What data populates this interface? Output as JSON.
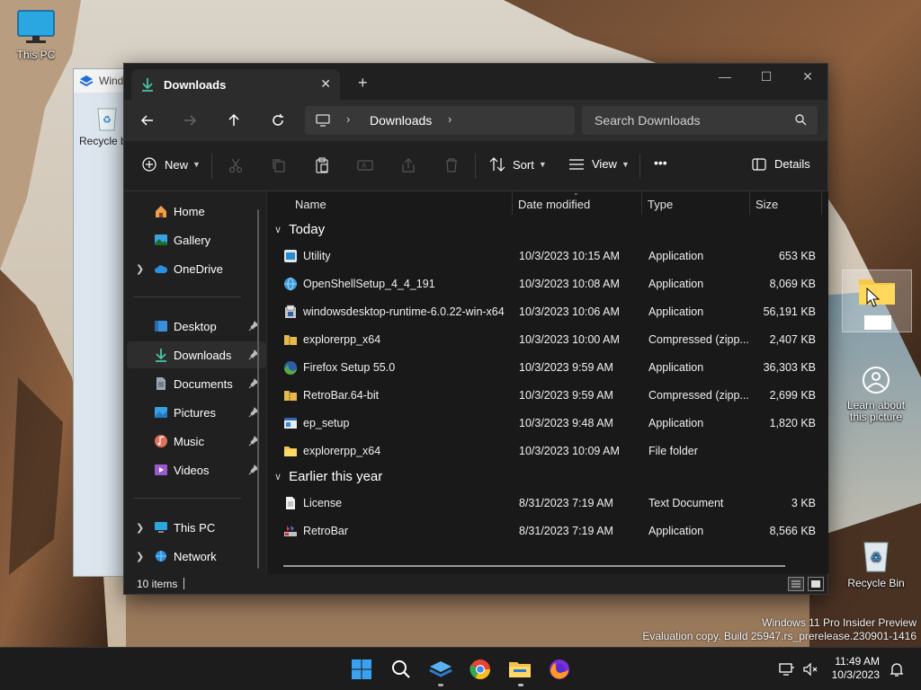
{
  "desktop": {
    "this_pc_label": "This PC",
    "learn_label_1": "Learn about",
    "learn_label_2": "this picture",
    "recycle_bin_label": "Recycle Bin",
    "watermark_line1": "Windows 11 Pro Insider Preview",
    "watermark_line2": "Evaluation copy. Build 25947.rs_prerelease.230901-1416"
  },
  "background_window": {
    "title": "Wind",
    "recycle_label": "Recycle b"
  },
  "explorer": {
    "tab_title": "Downloads",
    "new_tab": "+",
    "address_crumb": "Downloads",
    "search_placeholder": "Search Downloads",
    "toolbar": {
      "new_label": "New",
      "sort_label": "Sort",
      "view_label": "View",
      "more_label": "•••",
      "details_label": "Details"
    },
    "nav": [
      {
        "label": "Home"
      },
      {
        "label": "Gallery"
      },
      {
        "label": "OneDrive"
      },
      {
        "label": "Desktop"
      },
      {
        "label": "Downloads"
      },
      {
        "label": "Documents"
      },
      {
        "label": "Pictures"
      },
      {
        "label": "Music"
      },
      {
        "label": "Videos"
      },
      {
        "label": "This PC"
      },
      {
        "label": "Network"
      }
    ],
    "columns": {
      "name": "Name",
      "date": "Date modified",
      "type": "Type",
      "size": "Size"
    },
    "groups": [
      {
        "label": "Today",
        "files": [
          {
            "name": "Utility",
            "date": "10/3/2023 10:15 AM",
            "type": "Application",
            "size": "653 KB",
            "icon": "app-icon"
          },
          {
            "name": "OpenShellSetup_4_4_191",
            "date": "10/3/2023 10:08 AM",
            "type": "Application",
            "size": "8,069 KB",
            "icon": "globe-installer-icon"
          },
          {
            "name": "windowsdesktop-runtime-6.0.22-win-x64",
            "date": "10/3/2023 10:06 AM",
            "type": "Application",
            "size": "56,191 KB",
            "icon": "installer-icon"
          },
          {
            "name": "explorerpp_x64",
            "date": "10/3/2023 10:00 AM",
            "type": "Compressed (zipp...",
            "size": "2,407 KB",
            "icon": "zip-icon"
          },
          {
            "name": "Firefox Setup 55.0",
            "date": "10/3/2023 9:59 AM",
            "type": "Application",
            "size": "36,303 KB",
            "icon": "firefox-setup-icon"
          },
          {
            "name": "RetroBar.64-bit",
            "date": "10/3/2023 9:59 AM",
            "type": "Compressed (zipp...",
            "size": "2,699 KB",
            "icon": "zip-icon"
          },
          {
            "name": "ep_setup",
            "date": "10/3/2023 9:48 AM",
            "type": "Application",
            "size": "1,820 KB",
            "icon": "app-window-icon"
          },
          {
            "name": "explorerpp_x64",
            "date": "10/3/2023 10:09 AM",
            "type": "File folder",
            "size": "",
            "icon": "folder-icon"
          }
        ]
      },
      {
        "label": "Earlier this year",
        "files": [
          {
            "name": "License",
            "date": "8/31/2023 7:19 AM",
            "type": "Text Document",
            "size": "3 KB",
            "icon": "text-document-icon"
          },
          {
            "name": "RetroBar",
            "date": "8/31/2023 7:19 AM",
            "type": "Application",
            "size": "8,566 KB",
            "icon": "retrobar-icon"
          }
        ]
      }
    ],
    "status_count": "10 items"
  },
  "taskbar": {
    "time": "11:49 AM",
    "date": "10/3/2023"
  }
}
